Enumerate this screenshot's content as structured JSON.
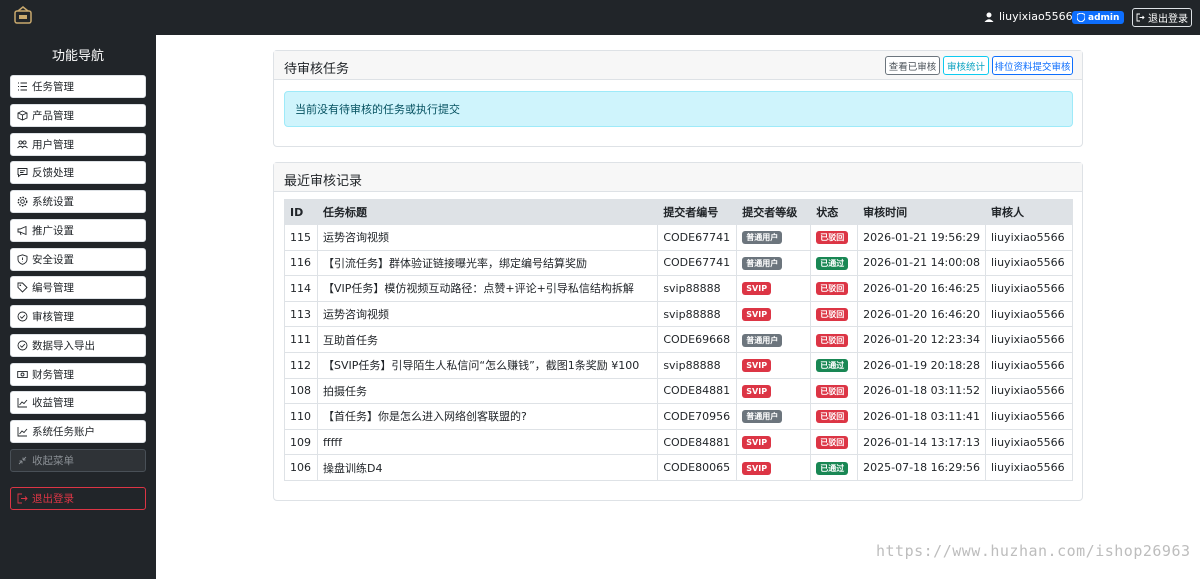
{
  "topbar": {
    "username": "liuyixiao5566",
    "role_badge": "admin",
    "logout_label": "退出登录"
  },
  "sidebar": {
    "title": "功能导航",
    "items": [
      {
        "label": "任务管理",
        "icon": "list-icon"
      },
      {
        "label": "产品管理",
        "icon": "box-icon"
      },
      {
        "label": "用户管理",
        "icon": "people-icon"
      },
      {
        "label": "反馈处理",
        "icon": "chat-icon"
      },
      {
        "label": "系统设置",
        "icon": "gear-icon"
      },
      {
        "label": "推广设置",
        "icon": "megaphone-icon"
      },
      {
        "label": "安全设置",
        "icon": "shield-icon"
      },
      {
        "label": "编号管理",
        "icon": "tag-icon"
      },
      {
        "label": "审核管理",
        "icon": "check-circle-icon"
      },
      {
        "label": "数据导入导出",
        "icon": "check-circle-icon"
      },
      {
        "label": "财务管理",
        "icon": "cash-icon"
      },
      {
        "label": "收益管理",
        "icon": "chart-line-icon"
      },
      {
        "label": "系统任务账户",
        "icon": "chart-line-icon"
      }
    ],
    "collapse_label": "收起菜单",
    "logout_label": "退出登录"
  },
  "pending": {
    "title": "待审核任务",
    "btn_view_reviewed": "查看已审核",
    "btn_stats": "审核统计",
    "btn_rank": "排位资料提交审核",
    "empty_message": "当前没有待审核的任务或执行提交"
  },
  "records": {
    "title": "最近审核记录",
    "columns": [
      "ID",
      "任务标题",
      "提交者编号",
      "提交者等级",
      "状态",
      "审核时间",
      "审核人"
    ],
    "rows": [
      {
        "id": "115",
        "title": "运势咨询视频",
        "code": "CODE67741",
        "level": "普通用户",
        "level_type": "grey",
        "status": "已驳回",
        "status_type": "red",
        "time": "2026-01-21 19:56:29",
        "reviewer": "liuyixiao5566"
      },
      {
        "id": "116",
        "title": "【引流任务】群体验证链接曝光率，绑定编号结算奖励",
        "code": "CODE67741",
        "level": "普通用户",
        "level_type": "grey",
        "status": "已通过",
        "status_type": "green",
        "time": "2026-01-21 14:00:08",
        "reviewer": "liuyixiao5566"
      },
      {
        "id": "114",
        "title": "【VIP任务】模仿视频互动路径：点赞+评论+引导私信结构拆解",
        "code": "svip88888",
        "level": "SVIP",
        "level_type": "red",
        "status": "已驳回",
        "status_type": "red",
        "time": "2026-01-20 16:46:25",
        "reviewer": "liuyixiao5566"
      },
      {
        "id": "113",
        "title": "运势咨询视频",
        "code": "svip88888",
        "level": "SVIP",
        "level_type": "red",
        "status": "已驳回",
        "status_type": "red",
        "time": "2026-01-20 16:46:20",
        "reviewer": "liuyixiao5566"
      },
      {
        "id": "111",
        "title": "互助首任务",
        "code": "CODE69668",
        "level": "普通用户",
        "level_type": "grey",
        "status": "已驳回",
        "status_type": "red",
        "time": "2026-01-20 12:23:34",
        "reviewer": "liuyixiao5566"
      },
      {
        "id": "112",
        "title": "【SVIP任务】引导陌生人私信问“怎么赚钱”，截图1条奖励 ¥100",
        "code": "svip88888",
        "level": "SVIP",
        "level_type": "red",
        "status": "已通过",
        "status_type": "green",
        "time": "2026-01-19 20:18:28",
        "reviewer": "liuyixiao5566"
      },
      {
        "id": "108",
        "title": "拍摄任务",
        "code": "CODE84881",
        "level": "SVIP",
        "level_type": "red",
        "status": "已驳回",
        "status_type": "red",
        "time": "2026-01-18 03:11:52",
        "reviewer": "liuyixiao5566"
      },
      {
        "id": "110",
        "title": "【首任务】你是怎么进入网络创客联盟的?",
        "code": "CODE70956",
        "level": "普通用户",
        "level_type": "grey",
        "status": "已驳回",
        "status_type": "red",
        "time": "2026-01-18 03:11:41",
        "reviewer": "liuyixiao5566"
      },
      {
        "id": "109",
        "title": "fffff",
        "code": "CODE84881",
        "level": "SVIP",
        "level_type": "red",
        "status": "已驳回",
        "status_type": "red",
        "time": "2026-01-14 13:17:13",
        "reviewer": "liuyixiao5566"
      },
      {
        "id": "106",
        "title": "操盘训练D4",
        "code": "CODE80065",
        "level": "SVIP",
        "level_type": "red",
        "status": "已通过",
        "status_type": "green",
        "time": "2025-07-18 16:29:56",
        "reviewer": "liuyixiao5566"
      }
    ]
  },
  "watermark": "https://www.huzhan.com/ishop26963",
  "colors": {
    "dark": "#212529",
    "primary": "#0d6efd",
    "danger": "#dc3545",
    "success": "#198754",
    "secondary": "#6c757d",
    "info_bg": "#cff4fc"
  }
}
